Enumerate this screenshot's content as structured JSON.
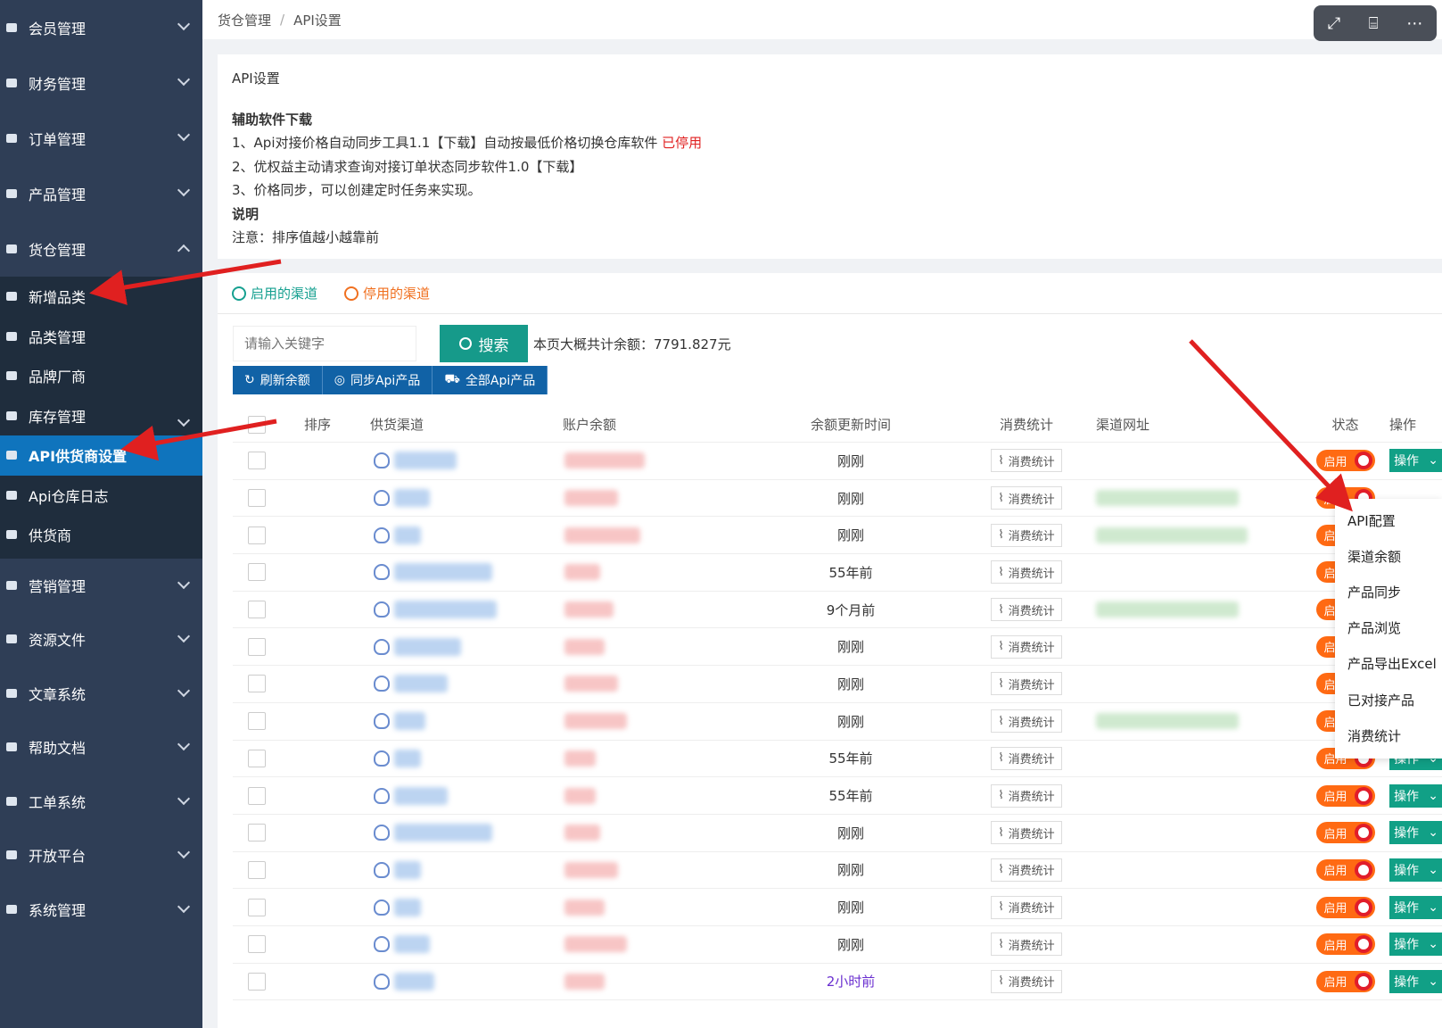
{
  "sidebar": {
    "items": [
      {
        "label": "会员管理",
        "icon": "users-icon",
        "expanded": false
      },
      {
        "label": "财务管理",
        "icon": "finance-icon",
        "expanded": false
      },
      {
        "label": "订单管理",
        "icon": "order-icon",
        "expanded": false
      },
      {
        "label": "产品管理",
        "icon": "cart-icon",
        "expanded": false
      },
      {
        "label": "货仓管理",
        "icon": "warehouse-icon",
        "expanded": true
      }
    ],
    "sub_items": [
      {
        "label": "新增品类",
        "icon": "plus-circle-icon"
      },
      {
        "label": "品类管理",
        "icon": "cart-icon"
      },
      {
        "label": "品牌厂商",
        "icon": "layers-icon"
      },
      {
        "label": "库存管理",
        "icon": "lock-icon",
        "has_chevron": true
      },
      {
        "label": "API供货商设置",
        "icon": "globe-icon",
        "active": true
      },
      {
        "label": "Api仓库日志",
        "icon": "document-icon"
      },
      {
        "label": "供货商",
        "icon": "user-icon"
      }
    ],
    "items_after": [
      {
        "label": "营销管理",
        "icon": "marketing-icon"
      },
      {
        "label": "资源文件",
        "icon": "file-icon"
      },
      {
        "label": "文章系统",
        "icon": "article-icon"
      },
      {
        "label": "帮助文档",
        "icon": "help-icon"
      },
      {
        "label": "工单系统",
        "icon": "ticket-icon"
      },
      {
        "label": "开放平台",
        "icon": "globe-icon"
      },
      {
        "label": "系统管理",
        "icon": "windows-icon"
      }
    ]
  },
  "breadcrumb": {
    "parent": "货仓管理",
    "separator": "/",
    "current": "API设置"
  },
  "info": {
    "title": "API设置",
    "download_heading": "辅助软件下载",
    "line1": "1、Api对接价格自动同步工具1.1【下载】自动按最低价格切换仓库软件",
    "line1_status": "已停用",
    "line2": "2、优权益主动请求查询对接订单状态同步软件1.0【下载】",
    "line3": "3、价格同步，可以创建定时任务来实现。",
    "note_heading": "说明",
    "note": "注意：排序值越小越靠前"
  },
  "tabs": {
    "enabled": "启用的渠道",
    "disabled": "停用的渠道"
  },
  "search": {
    "placeholder": "请输入关键字",
    "button": "搜索",
    "total_text": "本页大概共计余额：7791.827元"
  },
  "buttons": {
    "refresh": "刷新余额",
    "sync": "同步Api产品",
    "all": "全部Api产品"
  },
  "table": {
    "headers": [
      "排序",
      "供货渠道",
      "账户余额",
      "余额更新时间",
      "消费统计",
      "渠道网址",
      "状态",
      "操作"
    ],
    "stat_label": "消费统计",
    "state_label": "启用",
    "op_label": "操作",
    "rows": [
      {
        "time": "刚刚",
        "show_op": true,
        "url": false
      },
      {
        "time": "刚刚",
        "show_op": false,
        "url": true
      },
      {
        "time": "刚刚",
        "show_op": false,
        "url": true
      },
      {
        "time": "55年前",
        "show_op": false,
        "url": false
      },
      {
        "time": "9个月前",
        "show_op": false,
        "url": true
      },
      {
        "time": "刚刚",
        "show_op": false,
        "url": false
      },
      {
        "time": "刚刚",
        "show_op": false,
        "url": false
      },
      {
        "time": "刚刚",
        "show_op": false,
        "url": true
      },
      {
        "time": "55年前",
        "show_op": true,
        "url": false
      },
      {
        "time": "55年前",
        "show_op": true,
        "url": false
      },
      {
        "time": "刚刚",
        "show_op": true,
        "url": false
      },
      {
        "time": "刚刚",
        "show_op": true,
        "url": false
      },
      {
        "time": "刚刚",
        "show_op": true,
        "url": false
      },
      {
        "time": "刚刚",
        "show_op": true,
        "url": false
      },
      {
        "time": "2小时前",
        "show_op": true,
        "url": false
      }
    ]
  },
  "dropdown": [
    "API配置",
    "渠道余额",
    "产品同步",
    "产品浏览",
    "产品导出Excel",
    "已对接产品",
    "消费统计"
  ],
  "colors": {
    "sidebar": "#2f3e56",
    "active": "#0f74bd",
    "teal": "#169a8a",
    "orange": "#ff6a13",
    "arrow": "#e02020"
  }
}
